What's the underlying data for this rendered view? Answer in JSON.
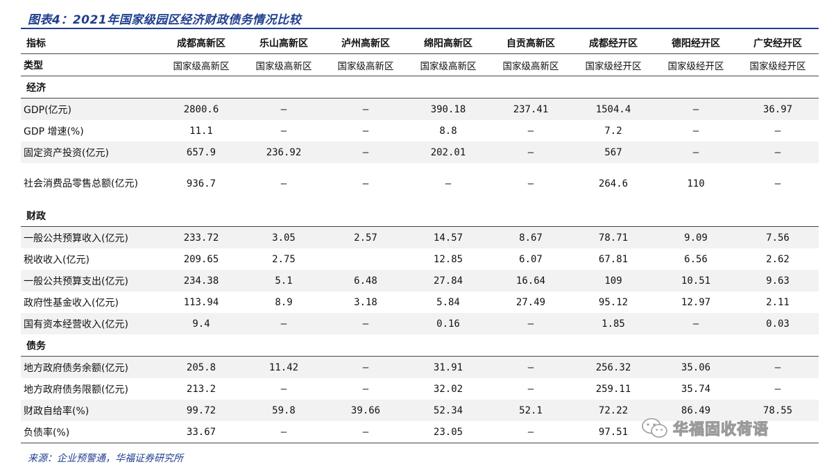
{
  "title": "图表4：2021年国家级园区经济财政债务情况比较",
  "source": "来源：企业预警通，华福证券研究所",
  "watermark": "华福固收荷语",
  "columns": [
    "指标",
    "成都高新区",
    "乐山高新区",
    "泸州高新区",
    "绵阳高新区",
    "自贡高新区",
    "成都经开区",
    "德阳经开区",
    "广安经开区"
  ],
  "type_row": {
    "label": "类型",
    "values": [
      "国家级高新区",
      "国家级高新区",
      "国家级高新区",
      "国家级高新区",
      "国家级高新区",
      "国家级经开区",
      "国家级经开区",
      "国家级经开区"
    ]
  },
  "sections": {
    "economy": {
      "label": "经济",
      "rows": [
        {
          "label": "GDP(亿元)",
          "values": [
            "2800.6",
            "–",
            "–",
            "390.18",
            "237.41",
            "1504.4",
            "–",
            "36.97"
          ]
        },
        {
          "label": "GDP 增速(%)",
          "values": [
            "11.1",
            "–",
            "–",
            "8.8",
            "–",
            "7.2",
            "–",
            "–"
          ]
        },
        {
          "label": "固定资产投资(亿元)",
          "values": [
            "657.9",
            "236.92",
            "–",
            "202.01",
            "–",
            "567",
            "–",
            "–"
          ]
        },
        {
          "label": "社会消费品零售总额(亿元)",
          "values": [
            "936.7",
            "–",
            "–",
            "–",
            "–",
            "264.6",
            "110",
            "–"
          ]
        }
      ]
    },
    "finance": {
      "label": "财政",
      "rows": [
        {
          "label": "一般公共预算收入(亿元)",
          "values": [
            "233.72",
            "3.05",
            "2.57",
            "14.57",
            "8.67",
            "78.71",
            "9.09",
            "7.56"
          ]
        },
        {
          "label": "税收收入(亿元)",
          "values": [
            "209.65",
            "2.75",
            "",
            "12.85",
            "6.07",
            "67.81",
            "6.56",
            "2.62"
          ]
        },
        {
          "label": "一般公共预算支出(亿元)",
          "values": [
            "234.38",
            "5.1",
            "6.48",
            "27.84",
            "16.64",
            "109",
            "10.51",
            "9.63"
          ]
        },
        {
          "label": "政府性基金收入(亿元)",
          "values": [
            "113.94",
            "8.9",
            "3.18",
            "5.84",
            "27.49",
            "95.12",
            "12.97",
            "2.11"
          ]
        },
        {
          "label": "国有资本经营收入(亿元)",
          "values": [
            "9.4",
            "–",
            "–",
            "0.16",
            "–",
            "1.85",
            "–",
            "0.03"
          ]
        }
      ]
    },
    "debt": {
      "label": "债务",
      "rows": [
        {
          "label": "地方政府债务余额(亿元)",
          "values": [
            "205.8",
            "11.42",
            "–",
            "31.91",
            "–",
            "256.32",
            "35.06",
            "–"
          ]
        },
        {
          "label": "地方政府债务限额(亿元)",
          "values": [
            "213.2",
            "–",
            "–",
            "32.02",
            "–",
            "259.11",
            "35.74",
            "–"
          ]
        },
        {
          "label": "财政自给率(%)",
          "values": [
            "99.72",
            "59.8",
            "39.66",
            "52.34",
            "52.1",
            "72.22",
            "86.49",
            "78.55"
          ]
        },
        {
          "label": "负债率(%)",
          "values": [
            "33.67",
            "–",
            "–",
            "23.05",
            "–",
            "97.51",
            "",
            ""
          ]
        }
      ]
    }
  }
}
